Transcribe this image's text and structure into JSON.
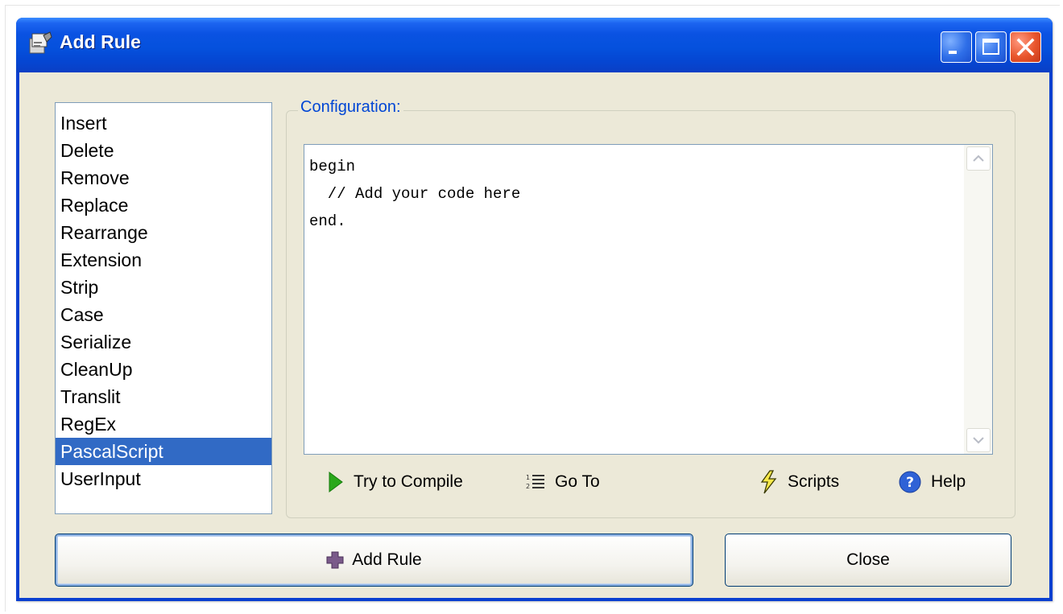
{
  "window": {
    "title": "Add Rule",
    "colors": {
      "titlebar": "#0a52e2",
      "client": "#ece9d8",
      "selection": "#316ac5",
      "group_label": "#0046d5"
    }
  },
  "rules_list": {
    "items": [
      {
        "label": "Insert",
        "selected": false
      },
      {
        "label": "Delete",
        "selected": false
      },
      {
        "label": "Remove",
        "selected": false
      },
      {
        "label": "Replace",
        "selected": false
      },
      {
        "label": "Rearrange",
        "selected": false
      },
      {
        "label": "Extension",
        "selected": false
      },
      {
        "label": "Strip",
        "selected": false
      },
      {
        "label": "Case",
        "selected": false
      },
      {
        "label": "Serialize",
        "selected": false
      },
      {
        "label": "CleanUp",
        "selected": false
      },
      {
        "label": "Translit",
        "selected": false
      },
      {
        "label": "RegEx",
        "selected": false
      },
      {
        "label": "PascalScript",
        "selected": true
      },
      {
        "label": "UserInput",
        "selected": false
      }
    ]
  },
  "configuration": {
    "label": "Configuration:",
    "code": "begin\n  // Add your code here\nend.",
    "actions": {
      "compile": {
        "label": "Try to Compile",
        "icon": "play-icon"
      },
      "goto": {
        "label": "Go To",
        "icon": "line-numbers-icon"
      },
      "scripts": {
        "label": "Scripts",
        "icon": "lightning-icon"
      },
      "help": {
        "label": "Help",
        "icon": "help-icon"
      }
    }
  },
  "buttons": {
    "add_rule": {
      "label": "Add Rule",
      "icon": "plus-icon"
    },
    "close": {
      "label": "Close"
    }
  }
}
